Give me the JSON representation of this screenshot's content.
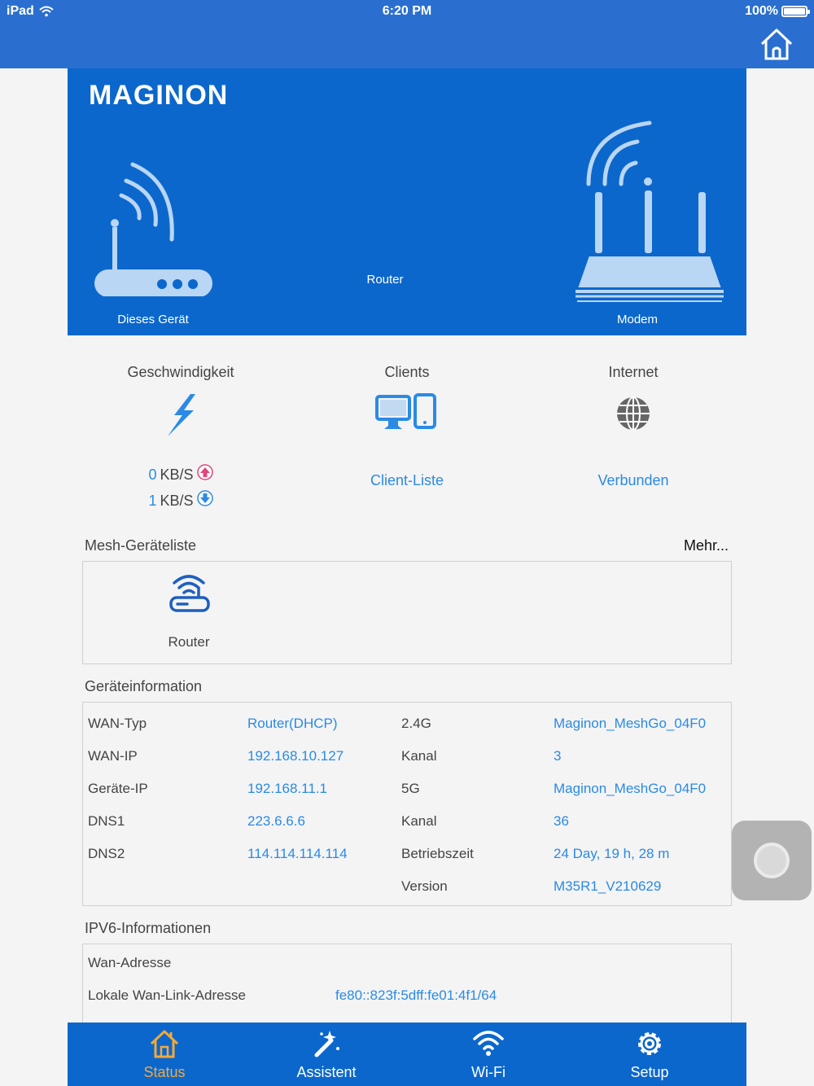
{
  "status_bar": {
    "device": "iPad",
    "time": "6:20 PM",
    "battery": "100%"
  },
  "hero": {
    "brand": "MAGINON",
    "this_device_label": "Dieses Gerät",
    "router_label": "Router",
    "modem_label": "Modem"
  },
  "stats": {
    "speed": {
      "title": "Geschwindigkeit",
      "up_value": "0",
      "up_unit": "KB/S",
      "down_value": "1",
      "down_unit": "KB/S"
    },
    "clients": {
      "title": "Clients",
      "link": "Client-Liste"
    },
    "internet": {
      "title": "Internet",
      "status": "Verbunden"
    }
  },
  "mesh": {
    "title": "Mesh-Geräteliste",
    "more": "Mehr...",
    "devices": [
      {
        "label": "Router"
      }
    ]
  },
  "device_info": {
    "title": "Geräteinformation",
    "left": [
      {
        "label": "WAN-Typ",
        "value": "Router(DHCP)"
      },
      {
        "label": "WAN-IP",
        "value": "192.168.10.127"
      },
      {
        "label": "Geräte-IP",
        "value": "192.168.11.1"
      },
      {
        "label": "DNS1",
        "value": "223.6.6.6"
      },
      {
        "label": "DNS2",
        "value": "114.114.114.114"
      }
    ],
    "right": [
      {
        "label": "2.4G",
        "value": "Maginon_MeshGo_04F0"
      },
      {
        "label": "Kanal",
        "value": "3"
      },
      {
        "label": "5G",
        "value": "Maginon_MeshGo_04F0"
      },
      {
        "label": "Kanal",
        "value": "36"
      },
      {
        "label": "Betriebszeit",
        "value": "24 Day, 19 h, 28 m"
      },
      {
        "label": "Version",
        "value": "M35R1_V210629"
      }
    ]
  },
  "ipv6": {
    "title": "IPV6-Informationen",
    "rows": [
      {
        "label": "Wan-Adresse",
        "value": ""
      },
      {
        "label": "Lokale Wan-Link-Adresse",
        "value": "fe80::823f:5dff:fe01:4f1/64"
      }
    ]
  },
  "tabs": [
    {
      "label": "Status",
      "icon": "home-icon",
      "active": true
    },
    {
      "label": "Assistent",
      "icon": "magic-wand-icon"
    },
    {
      "label": "Wi-Fi",
      "icon": "wifi-icon"
    },
    {
      "label": "Setup",
      "icon": "gear-icon"
    }
  ],
  "colors": {
    "primary": "#0b67cc",
    "header": "#2a6fd0",
    "link": "#2a8ae6",
    "active_tab": "#f2a93b",
    "upload_arrow": "#e0457b"
  }
}
